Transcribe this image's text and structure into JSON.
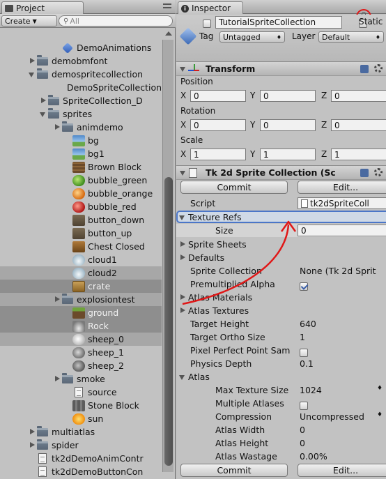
{
  "project": {
    "tab_label": "Project",
    "create_label": "Create",
    "search_placeholder": "All",
    "items": [
      {
        "label": "DemoAnimations",
        "indent": 3,
        "kind": "prefab",
        "arrow": "none"
      },
      {
        "label": "demobmfont",
        "indent": 1,
        "kind": "folder",
        "arrow": "right"
      },
      {
        "label": "demospritecollection",
        "indent": 1,
        "kind": "folder",
        "arrow": "down"
      },
      {
        "label": "DemoSpriteCollection",
        "indent": 3,
        "kind": "prefab",
        "arrow": "none"
      },
      {
        "label": "SpriteCollection_D",
        "indent": 2,
        "kind": "folder",
        "arrow": "right"
      },
      {
        "label": "sprites",
        "indent": 2,
        "kind": "folder",
        "arrow": "down"
      },
      {
        "label": "animdemo",
        "indent": 3,
        "kind": "folder",
        "arrow": "right"
      },
      {
        "label": "bg",
        "indent": 4,
        "kind": "tex-bg",
        "arrow": "none"
      },
      {
        "label": "bg1",
        "indent": 4,
        "kind": "tex-bg",
        "arrow": "none"
      },
      {
        "label": "Brown Block",
        "indent": 4,
        "kind": "tex-brown",
        "arrow": "none"
      },
      {
        "label": "bubble_green",
        "indent": 4,
        "kind": "tex-green",
        "arrow": "none"
      },
      {
        "label": "bubble_orange",
        "indent": 4,
        "kind": "tex-orange",
        "arrow": "none"
      },
      {
        "label": "bubble_red",
        "indent": 4,
        "kind": "tex-red",
        "arrow": "none"
      },
      {
        "label": "button_down",
        "indent": 4,
        "kind": "tex-button",
        "arrow": "none"
      },
      {
        "label": "button_up",
        "indent": 4,
        "kind": "tex-button",
        "arrow": "none"
      },
      {
        "label": "Chest Closed",
        "indent": 4,
        "kind": "tex-chest",
        "arrow": "none"
      },
      {
        "label": "cloud1",
        "indent": 4,
        "kind": "tex-cloud",
        "arrow": "none"
      },
      {
        "label": "cloud2",
        "indent": 4,
        "kind": "tex-cloud",
        "arrow": "none",
        "state": "hov"
      },
      {
        "label": "crate",
        "indent": 4,
        "kind": "tex-crate",
        "arrow": "none",
        "state": "sel"
      },
      {
        "label": "explosiontest",
        "indent": 3,
        "kind": "folder",
        "arrow": "right",
        "state": "hov"
      },
      {
        "label": "ground",
        "indent": 4,
        "kind": "tex-ground",
        "arrow": "none",
        "state": "sel"
      },
      {
        "label": "Rock",
        "indent": 4,
        "kind": "tex-rock",
        "arrow": "none",
        "state": "sel"
      },
      {
        "label": "sheep_0",
        "indent": 4,
        "kind": "tex-sheep0",
        "arrow": "none",
        "state": "hov"
      },
      {
        "label": "sheep_1",
        "indent": 4,
        "kind": "tex-sheep1",
        "arrow": "none"
      },
      {
        "label": "sheep_2",
        "indent": 4,
        "kind": "tex-sheep2",
        "arrow": "none"
      },
      {
        "label": "smoke",
        "indent": 3,
        "kind": "folder",
        "arrow": "right"
      },
      {
        "label": "source",
        "indent": 4,
        "kind": "doc",
        "arrow": "none"
      },
      {
        "label": "Stone Block",
        "indent": 4,
        "kind": "tex-stone",
        "arrow": "none"
      },
      {
        "label": "sun",
        "indent": 4,
        "kind": "tex-sun",
        "arrow": "none"
      },
      {
        "label": "multiatlas",
        "indent": 1,
        "kind": "folder",
        "arrow": "right"
      },
      {
        "label": "spider",
        "indent": 1,
        "kind": "folder",
        "arrow": "right"
      },
      {
        "label": "tk2dDemoAnimContr",
        "indent": 1,
        "kind": "doc",
        "arrow": "none"
      },
      {
        "label": "tk2dDemoButtonCon",
        "indent": 1,
        "kind": "doc",
        "arrow": "none"
      }
    ]
  },
  "inspector": {
    "tab_label": "Inspector",
    "object_name": "TutorialSpriteCollection",
    "static_label": "Static",
    "tag_label": "Tag",
    "tag_value": "Untagged",
    "layer_label": "Layer",
    "layer_value": "Default",
    "transform": {
      "title": "Transform",
      "position_label": "Position",
      "rotation_label": "Rotation",
      "scale_label": "Scale",
      "x": "X",
      "y": "Y",
      "z": "Z",
      "position": [
        "0",
        "0",
        "0"
      ],
      "rotation": [
        "0",
        "0",
        "0"
      ],
      "scale": [
        "1",
        "1",
        "1"
      ]
    },
    "collection": {
      "title": "Tk 2d Sprite Collection (Sc",
      "commit_label": "Commit",
      "edit_label": "Edit...",
      "script_label": "Script",
      "script_value": "tk2dSpriteColl",
      "texture_refs_label": "Texture Refs",
      "size_label": "Size",
      "size_value": "0",
      "sprite_sheets_label": "Sprite Sheets",
      "defaults_label": "Defaults",
      "sprite_collection_label": "Sprite Collection",
      "sprite_collection_value": "None (Tk 2d Sprit",
      "premultiplied_label": "Premultiplied Alpha",
      "atlas_materials_label": "Atlas Materials",
      "atlas_textures_label": "Atlas Textures",
      "target_height_label": "Target Height",
      "target_height_value": "640",
      "target_ortho_label": "Target Ortho Size",
      "target_ortho_value": "1",
      "pixel_perfect_label": "Pixel Perfect Point Sam",
      "physics_depth_label": "Physics Depth",
      "physics_depth_value": "0.1",
      "atlas_label": "Atlas",
      "max_texture_label": "Max Texture Size",
      "max_texture_value": "1024",
      "multiple_atlases_label": "Multiple Atlases",
      "compression_label": "Compression",
      "compression_value": "Uncompressed",
      "atlas_width_label": "Atlas Width",
      "atlas_width_value": "0",
      "atlas_height_label": "Atlas Height",
      "atlas_height_value": "0",
      "atlas_wastage_label": "Atlas Wastage",
      "atlas_wastage_value": "0.00%"
    }
  },
  "colors": {
    "annotation_red": "#e01818",
    "highlight_blue": "#4b76c8",
    "selection_gray": "#8e8e8e"
  }
}
